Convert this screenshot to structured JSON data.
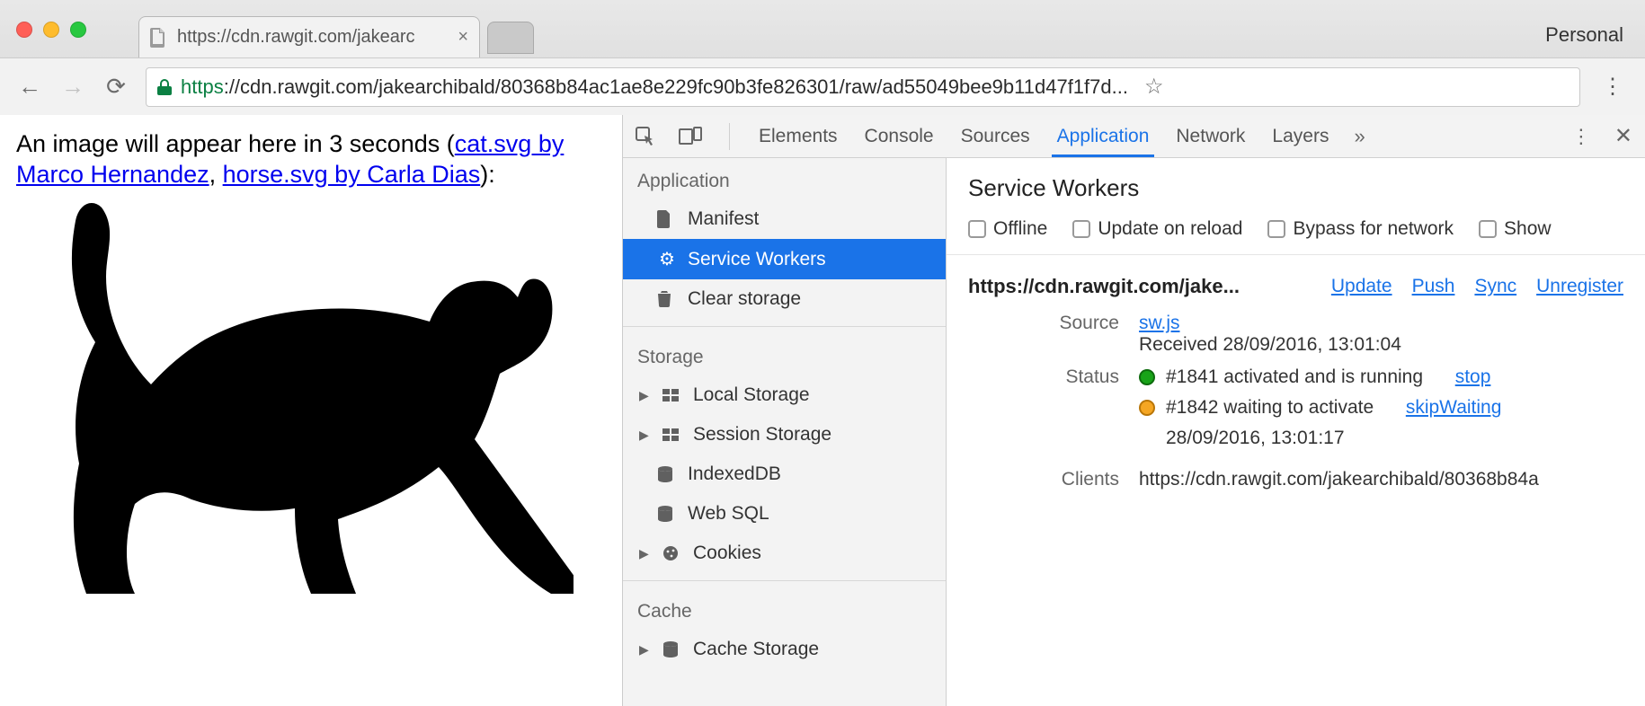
{
  "chrome": {
    "profile": "Personal",
    "tab_title": "https://cdn.rawgit.com/jakearc",
    "url_protocol": "https",
    "url_rest": "://cdn.rawgit.com/jakearchibald/80368b84ac1ae8e229fc90b3fe826301/raw/ad55049bee9b11d47f1f7d..."
  },
  "page": {
    "intro_before": "An image will appear here in 3 seconds (",
    "link1": "cat.svg by Marco Hernandez",
    "comma": ", ",
    "link2": "horse.svg by Carla Dias",
    "intro_after": "):"
  },
  "devtools": {
    "tabs": [
      "Elements",
      "Console",
      "Sources",
      "Application",
      "Network",
      "Layers"
    ],
    "active_tab": "Application",
    "more": "»",
    "sidebar": {
      "groups": [
        {
          "title": "Application",
          "items": [
            {
              "label": "Manifest",
              "icon": "file"
            },
            {
              "label": "Service Workers",
              "icon": "gear",
              "selected": true
            },
            {
              "label": "Clear storage",
              "icon": "trash"
            }
          ]
        },
        {
          "title": "Storage",
          "items": [
            {
              "label": "Local Storage",
              "icon": "grid",
              "expandable": true
            },
            {
              "label": "Session Storage",
              "icon": "grid",
              "expandable": true
            },
            {
              "label": "IndexedDB",
              "icon": "db"
            },
            {
              "label": "Web SQL",
              "icon": "db"
            },
            {
              "label": "Cookies",
              "icon": "cookie",
              "expandable": true
            }
          ]
        },
        {
          "title": "Cache",
          "items": [
            {
              "label": "Cache Storage",
              "icon": "db",
              "expandable": true
            }
          ]
        }
      ]
    },
    "panel": {
      "title": "Service Workers",
      "options": [
        "Offline",
        "Update on reload",
        "Bypass for network",
        "Show"
      ],
      "origin": "https://cdn.rawgit.com/jake...",
      "origin_actions": [
        "Update",
        "Push",
        "Sync",
        "Unregister"
      ],
      "source_label": "Source",
      "source_file": "sw.js",
      "source_received": "Received 28/09/2016, 13:01:04",
      "status_label": "Status",
      "status_items": [
        {
          "color": "green",
          "text": "#1841 activated and is running",
          "action": "stop"
        },
        {
          "color": "orange",
          "text": "#1842 waiting to activate",
          "action": "skipWaiting",
          "sub": "28/09/2016, 13:01:17"
        }
      ],
      "clients_label": "Clients",
      "clients_value": "https://cdn.rawgit.com/jakearchibald/80368b84a"
    }
  }
}
